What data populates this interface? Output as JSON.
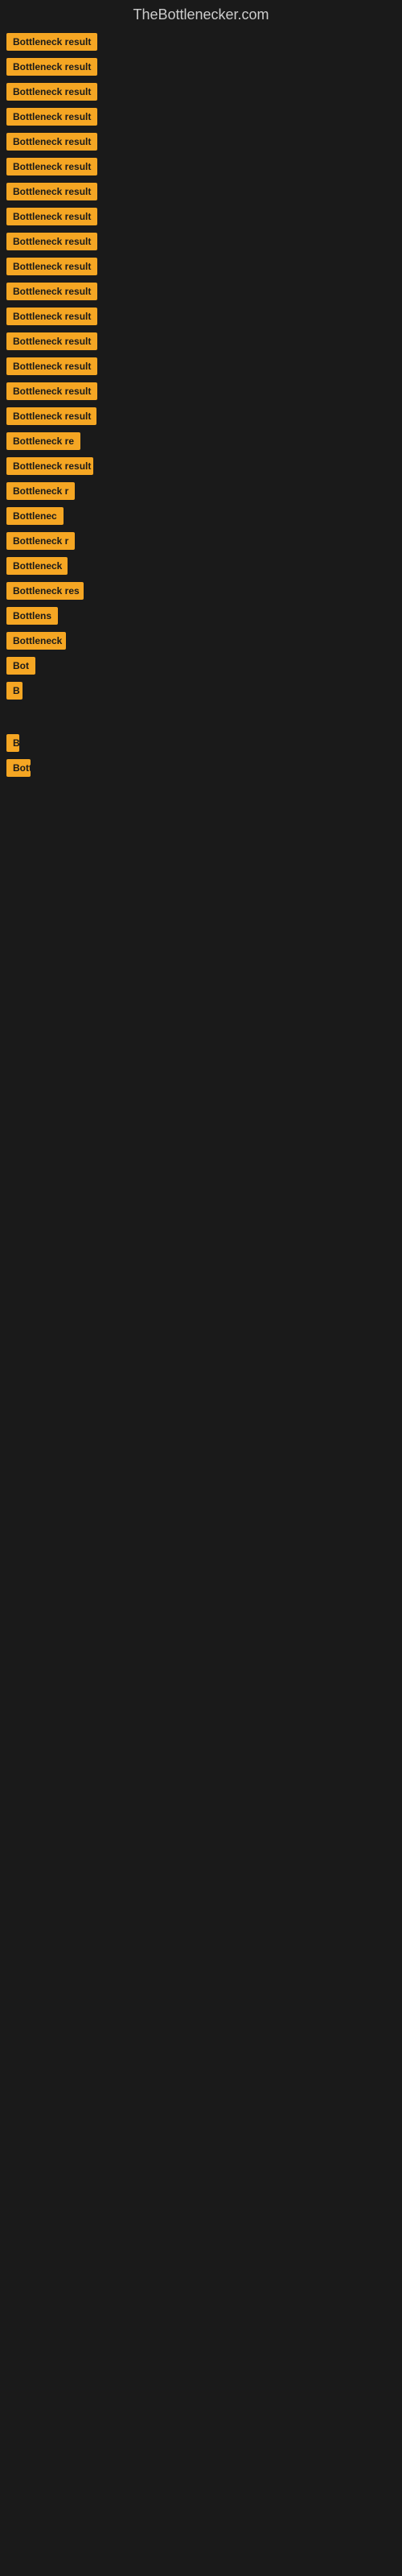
{
  "site": {
    "title": "TheBottlenecker.com"
  },
  "items": [
    {
      "id": 1,
      "label": "Bottleneck result",
      "width": 130
    },
    {
      "id": 2,
      "label": "Bottleneck result",
      "width": 130
    },
    {
      "id": 3,
      "label": "Bottleneck result",
      "width": 130
    },
    {
      "id": 4,
      "label": "Bottleneck result",
      "width": 130
    },
    {
      "id": 5,
      "label": "Bottleneck result",
      "width": 130
    },
    {
      "id": 6,
      "label": "Bottleneck result",
      "width": 128
    },
    {
      "id": 7,
      "label": "Bottleneck result",
      "width": 128
    },
    {
      "id": 8,
      "label": "Bottleneck result",
      "width": 126
    },
    {
      "id": 9,
      "label": "Bottleneck result",
      "width": 125
    },
    {
      "id": 10,
      "label": "Bottleneck result",
      "width": 124
    },
    {
      "id": 11,
      "label": "Bottleneck result",
      "width": 122
    },
    {
      "id": 12,
      "label": "Bottleneck result",
      "width": 120
    },
    {
      "id": 13,
      "label": "Bottleneck result",
      "width": 118
    },
    {
      "id": 14,
      "label": "Bottleneck result",
      "width": 116
    },
    {
      "id": 15,
      "label": "Bottleneck result",
      "width": 114
    },
    {
      "id": 16,
      "label": "Bottleneck result",
      "width": 112
    },
    {
      "id": 17,
      "label": "Bottleneck re",
      "width": 100
    },
    {
      "id": 18,
      "label": "Bottleneck result",
      "width": 108
    },
    {
      "id": 19,
      "label": "Bottleneck r",
      "width": 90
    },
    {
      "id": 20,
      "label": "Bottlenec",
      "width": 78
    },
    {
      "id": 21,
      "label": "Bottleneck r",
      "width": 88
    },
    {
      "id": 22,
      "label": "Bottleneck",
      "width": 76
    },
    {
      "id": 23,
      "label": "Bottleneck res",
      "width": 96
    },
    {
      "id": 24,
      "label": "Bottlens",
      "width": 66
    },
    {
      "id": 25,
      "label": "Bottleneck",
      "width": 74
    },
    {
      "id": 26,
      "label": "Bot",
      "width": 38
    },
    {
      "id": 27,
      "label": "B",
      "width": 20
    },
    {
      "id": 28,
      "label": "",
      "width": 0
    },
    {
      "id": 29,
      "label": "B",
      "width": 16
    },
    {
      "id": 30,
      "label": "Bott",
      "width": 30
    }
  ]
}
